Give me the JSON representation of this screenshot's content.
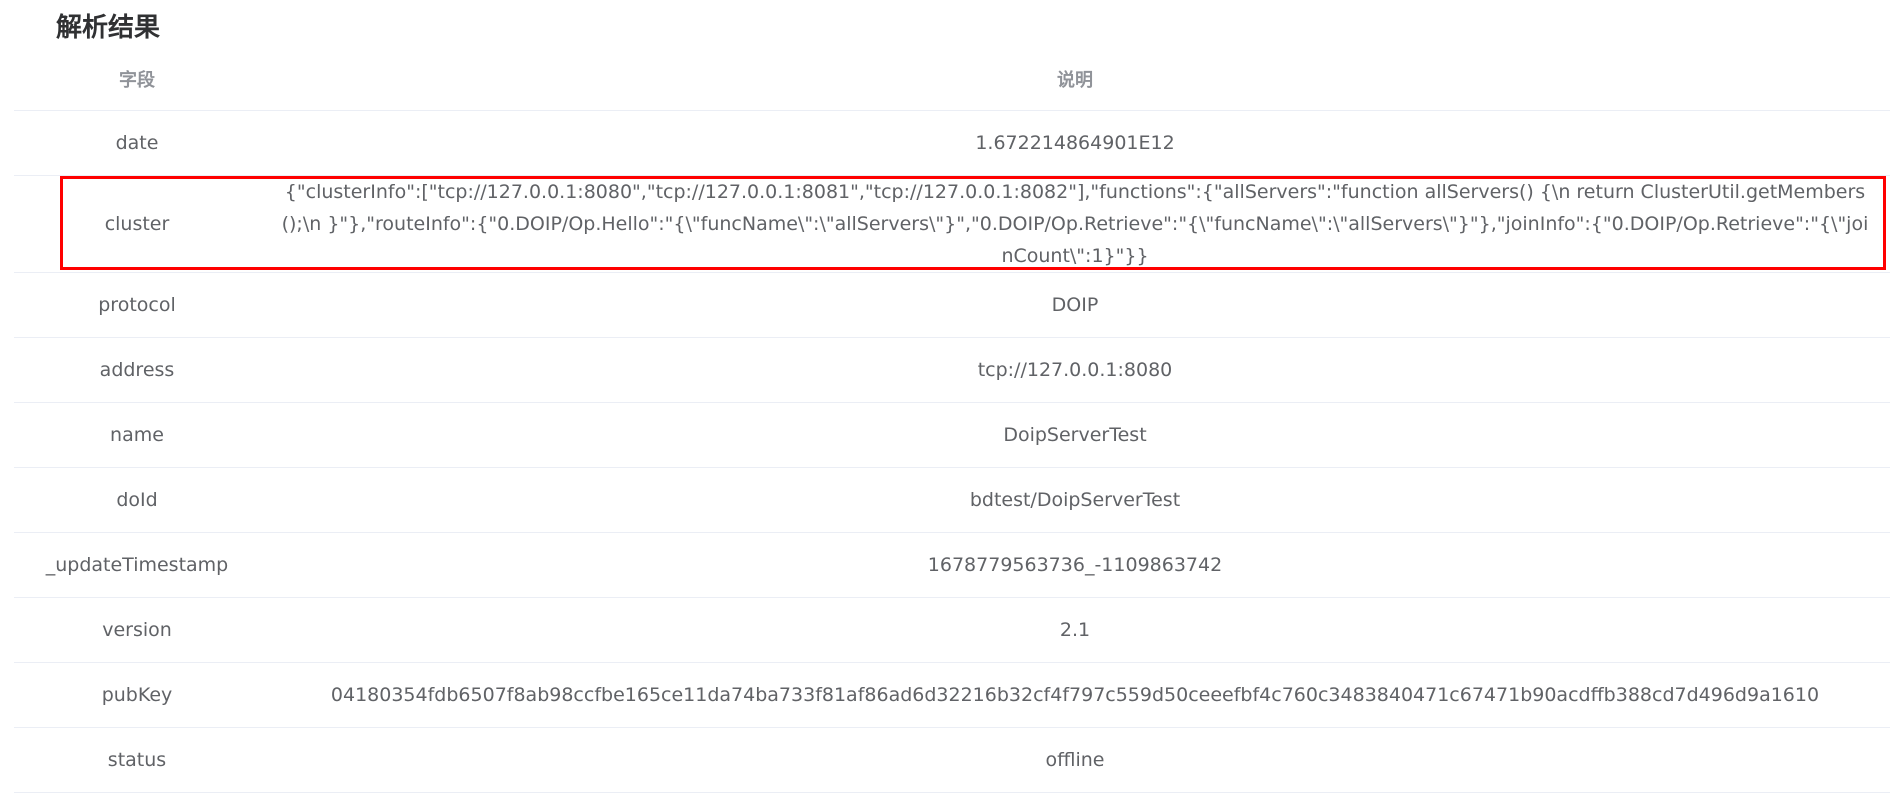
{
  "page": {
    "title": "解析结果",
    "highlight_color": "#ff0000"
  },
  "table": {
    "headers": {
      "field": "字段",
      "description": "说明"
    },
    "rows": [
      {
        "field": "date",
        "value": "1.672214864901E12"
      },
      {
        "field": "cluster",
        "value": "{\"clusterInfo\":[\"tcp://127.0.0.1:8080\",\"tcp://127.0.0.1:8081\",\"tcp://127.0.0.1:8082\"],\"functions\":{\"allServers\":\"function allServers() {\\n return ClusterUtil.getMembers();\\n }\"},\"routeInfo\":{\"0.DOIP/Op.Hello\":\"{\\\"funcName\\\":\\\"allServers\\\"}\",\"0.DOIP/Op.Retrieve\":\"{\\\"funcName\\\":\\\"allServers\\\"}\"},\"joinInfo\":{\"0.DOIP/Op.Retrieve\":\"{\\\"joinCount\\\":1}\"}}"
      },
      {
        "field": "protocol",
        "value": "DOIP"
      },
      {
        "field": "address",
        "value": "tcp://127.0.0.1:8080"
      },
      {
        "field": "name",
        "value": "DoipServerTest"
      },
      {
        "field": "doId",
        "value": "bdtest/DoipServerTest"
      },
      {
        "field": "_updateTimestamp",
        "value": "1678779563736_-1109863742"
      },
      {
        "field": "version",
        "value": "2.1"
      },
      {
        "field": "pubKey",
        "value": "04180354fdb6507f8ab98ccfbe165ce11da74ba733f81af86ad6d32216b32cf4f797c559d50ceeefbf4c760c3483840471c67471b90acdffb388cd7d496d9a1610"
      },
      {
        "field": "status",
        "value": "offline"
      }
    ]
  }
}
